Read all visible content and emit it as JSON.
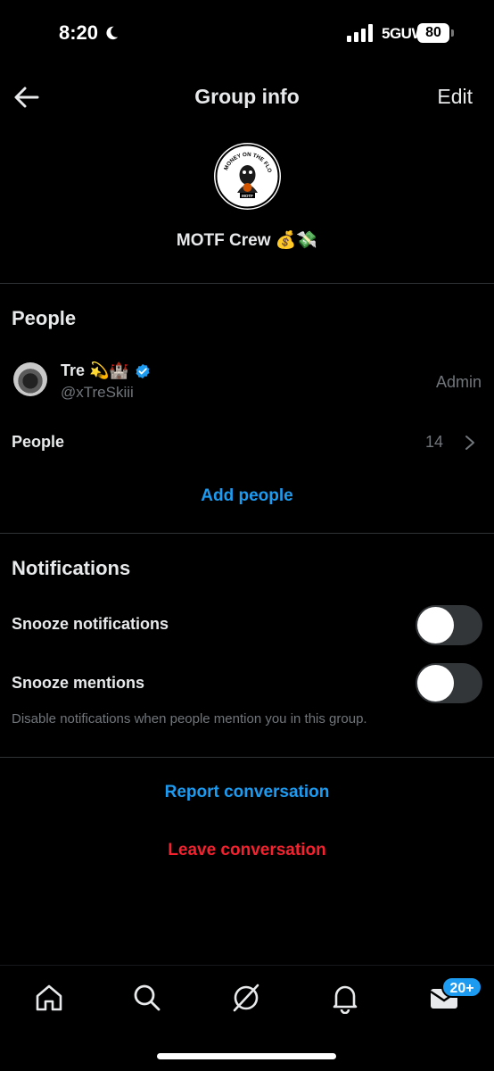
{
  "status_bar": {
    "time": "8:20",
    "network": "5GUW",
    "battery": "80"
  },
  "header": {
    "title": "Group info",
    "edit_label": "Edit"
  },
  "group": {
    "name": "MOTF Crew 💰💸",
    "avatar_text": "MONEY ON THE FLOOR",
    "avatar_subtext": "MOTF"
  },
  "people_section": {
    "title": "People",
    "member": {
      "name": "Tre 💫🏰",
      "handle": "@xTreSkiii",
      "role": "Admin"
    },
    "people_row": {
      "label": "People",
      "count": "14"
    },
    "add_people_label": "Add people"
  },
  "notifications_section": {
    "title": "Notifications",
    "snooze_notifications": {
      "label": "Snooze notifications",
      "on": false
    },
    "snooze_mentions": {
      "label": "Snooze mentions",
      "on": false
    },
    "hint": "Disable notifications when people mention you in this group."
  },
  "actions": {
    "report": "Report conversation",
    "leave": "Leave conversation"
  },
  "tabbar": {
    "tabs": [
      "home-icon",
      "search-icon",
      "grok-icon",
      "bell-icon",
      "mail-icon"
    ],
    "badge": "20+"
  },
  "colors": {
    "accent": "#1d9bf0",
    "danger": "#f4212e",
    "muted": "#71767b",
    "background": "#000000"
  }
}
